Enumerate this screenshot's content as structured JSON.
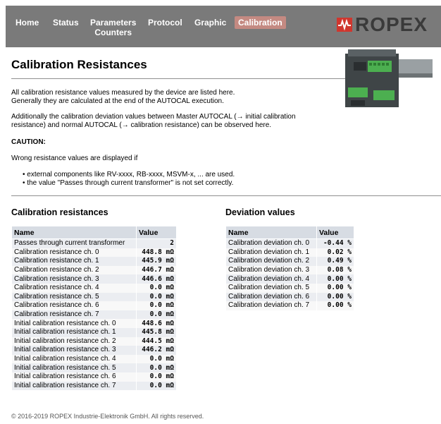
{
  "nav": {
    "home": "Home",
    "status": "Status",
    "parameters": "Parameters",
    "counters": "Counters",
    "protocol": "Protocol",
    "graphic": "Graphic",
    "calibration": "Calibration"
  },
  "brand": {
    "logo_text": "ROPEX",
    "accent": "#d0362e"
  },
  "page": {
    "title": "Calibration Resistances",
    "intro_1": "All calibration resistance values measured by the device are listed here.",
    "intro_2": "Generally they are calculated at the end of the AUTOCAL execution.",
    "add_1": "Additionally the calibration deviation values between Master AUTOCAL (→ initial calibration",
    "add_2": "resistance) and normal AUTOCAL (→ calibration resistance) can be observed here.",
    "caution": "CAUTION:",
    "wrong": "Wrong resistance values are displayed if",
    "bullets": [
      "external components like RV-xxxx, RB-xxxx, MSVM-x, ... are used.",
      "the value \"Passes through current transformer\" is not set correctly."
    ]
  },
  "calibration_table": {
    "heading": "Calibration resistances",
    "col_name": "Name",
    "col_value": "Value",
    "rows": [
      [
        "Passes through current transformer",
        "2"
      ],
      [
        "Calibration resistance ch. 0",
        "448.8 mΩ"
      ],
      [
        "Calibration resistance ch. 1",
        "445.9 mΩ"
      ],
      [
        "Calibration resistance ch. 2",
        "446.7 mΩ"
      ],
      [
        "Calibration resistance ch. 3",
        "446.6 mΩ"
      ],
      [
        "Calibration resistance ch. 4",
        "0.0 mΩ"
      ],
      [
        "Calibration resistance ch. 5",
        "0.0 mΩ"
      ],
      [
        "Calibration resistance ch. 6",
        "0.0 mΩ"
      ],
      [
        "Calibration resistance ch. 7",
        "0.0 mΩ"
      ],
      [
        "Initial calibration resistance ch. 0",
        "448.6 mΩ"
      ],
      [
        "Initial calibration resistance ch. 1",
        "445.8 mΩ"
      ],
      [
        "Initial calibration resistance ch. 2",
        "444.5 mΩ"
      ],
      [
        "Initial calibration resistance ch. 3",
        "446.2 mΩ"
      ],
      [
        "Initial calibration resistance ch. 4",
        "0.0 mΩ"
      ],
      [
        "Initial calibration resistance ch. 5",
        "0.0 mΩ"
      ],
      [
        "Initial calibration resistance ch. 6",
        "0.0 mΩ"
      ],
      [
        "Initial calibration resistance ch. 7",
        "0.0 mΩ"
      ]
    ]
  },
  "deviation_table": {
    "heading": "Deviation values",
    "col_name": "Name",
    "col_value": "Value",
    "rows": [
      [
        "Calibration deviation ch. 0",
        "-0.44 %"
      ],
      [
        "Calibration deviation ch. 1",
        "0.02 %"
      ],
      [
        "Calibration deviation ch. 2",
        "0.49 %"
      ],
      [
        "Calibration deviation ch. 3",
        "0.08 %"
      ],
      [
        "Calibration deviation ch. 4",
        "0.00 %"
      ],
      [
        "Calibration deviation ch. 5",
        "0.00 %"
      ],
      [
        "Calibration deviation ch. 6",
        "0.00 %"
      ],
      [
        "Calibration deviation ch. 7",
        "0.00 %"
      ]
    ]
  },
  "footer": "© 2016-2019 ROPEX Industrie-Elektronik GmbH. All rights reserved."
}
